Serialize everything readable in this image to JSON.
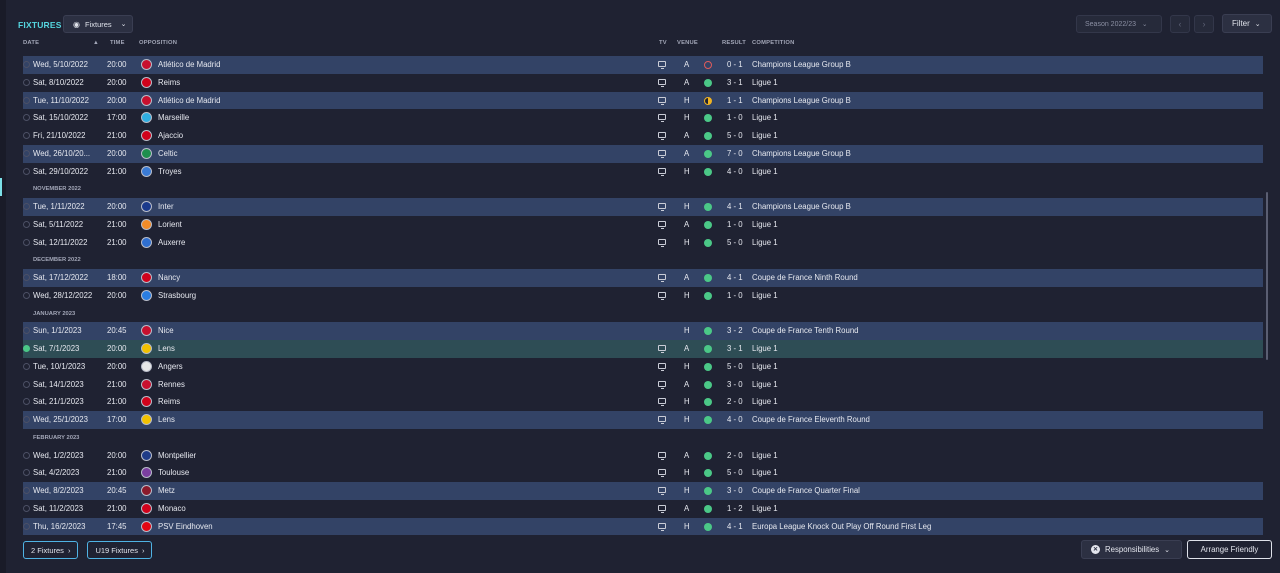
{
  "title": "FIXTURES",
  "view_button": {
    "label": "Fixtures",
    "icon": "eye-icon"
  },
  "season": {
    "label": "Season 2022/23"
  },
  "filter_label": "Filter",
  "columns": {
    "date": "DATE",
    "time": "TIME",
    "opposition": "OPPOSITION",
    "tv": "TV",
    "venue": "VENUE",
    "result": "RESULT",
    "competition": "COMPETITION"
  },
  "rows": [
    {
      "kind": "fixture",
      "style": "alt",
      "date": "Wed, 5/10/2022",
      "time": "20:00",
      "opponent": "Atlético de Madrid",
      "crest": "#c8102e",
      "tv": true,
      "venue": "A",
      "outcome": "loss",
      "score": "0 - 1",
      "competition": "Champions League Group B"
    },
    {
      "kind": "fixture",
      "style": "plain",
      "date": "Sat, 8/10/2022",
      "time": "20:00",
      "opponent": "Reims",
      "crest": "#d0021b",
      "tv": true,
      "venue": "A",
      "outcome": "win",
      "score": "3 - 1",
      "competition": "Ligue 1"
    },
    {
      "kind": "fixture",
      "style": "alt",
      "date": "Tue, 11/10/2022",
      "time": "20:00",
      "opponent": "Atlético de Madrid",
      "crest": "#c8102e",
      "tv": true,
      "venue": "H",
      "outcome": "draw",
      "score": "1 - 1",
      "competition": "Champions League Group B"
    },
    {
      "kind": "fixture",
      "style": "plain",
      "date": "Sat, 15/10/2022",
      "time": "17:00",
      "opponent": "Marseille",
      "crest": "#2faee0",
      "tv": true,
      "venue": "H",
      "outcome": "win",
      "score": "1 - 0",
      "competition": "Ligue 1"
    },
    {
      "kind": "fixture",
      "style": "plain",
      "date": "Fri, 21/10/2022",
      "time": "21:00",
      "opponent": "Ajaccio",
      "crest": "#d0021b",
      "tv": true,
      "venue": "A",
      "outcome": "win",
      "score": "5 - 0",
      "competition": "Ligue 1"
    },
    {
      "kind": "fixture",
      "style": "alt",
      "date": "Wed, 26/10/20...",
      "time": "20:00",
      "opponent": "Celtic",
      "crest": "#1e8f4e",
      "tv": true,
      "venue": "A",
      "outcome": "win",
      "score": "7 - 0",
      "competition": "Champions League Group B"
    },
    {
      "kind": "fixture",
      "style": "plain",
      "date": "Sat, 29/10/2022",
      "time": "21:00",
      "opponent": "Troyes",
      "crest": "#3a7bd5",
      "tv": true,
      "venue": "H",
      "outcome": "win",
      "score": "4 - 0",
      "competition": "Ligue 1"
    },
    {
      "kind": "month",
      "label": "NOVEMBER 2022"
    },
    {
      "kind": "fixture",
      "style": "alt",
      "date": "Tue, 1/11/2022",
      "time": "20:00",
      "opponent": "Inter",
      "crest": "#1b3a8c",
      "tv": true,
      "venue": "H",
      "outcome": "win",
      "score": "4 - 1",
      "competition": "Champions League Group B"
    },
    {
      "kind": "fixture",
      "style": "plain",
      "date": "Sat, 5/11/2022",
      "time": "21:00",
      "opponent": "Lorient",
      "crest": "#f28c28",
      "tv": true,
      "venue": "A",
      "outcome": "win",
      "score": "1 - 0",
      "competition": "Ligue 1"
    },
    {
      "kind": "fixture",
      "style": "plain",
      "date": "Sat, 12/11/2022",
      "time": "21:00",
      "opponent": "Auxerre",
      "crest": "#2f6fd0",
      "tv": true,
      "venue": "H",
      "outcome": "win",
      "score": "5 - 0",
      "competition": "Ligue 1"
    },
    {
      "kind": "month",
      "label": "DECEMBER 2022"
    },
    {
      "kind": "fixture",
      "style": "alt",
      "date": "Sat, 17/12/2022",
      "time": "18:00",
      "opponent": "Nancy",
      "crest": "#d0021b",
      "tv": true,
      "venue": "A",
      "outcome": "win",
      "score": "4 - 1",
      "competition": "Coupe de France Ninth Round"
    },
    {
      "kind": "fixture",
      "style": "plain",
      "date": "Wed, 28/12/2022",
      "time": "20:00",
      "opponent": "Strasbourg",
      "crest": "#2a7de1",
      "tv": true,
      "venue": "H",
      "outcome": "win",
      "score": "1 - 0",
      "competition": "Ligue 1"
    },
    {
      "kind": "month",
      "label": "JANUARY 2023"
    },
    {
      "kind": "fixture",
      "style": "alt",
      "date": "Sun, 1/1/2023",
      "time": "20:45",
      "opponent": "Nice",
      "crest": "#c8102e",
      "tv": false,
      "venue": "H",
      "outcome": "win",
      "score": "3 - 2",
      "competition": "Coupe de France Tenth Round"
    },
    {
      "kind": "fixture",
      "style": "current",
      "date": "Sat, 7/1/2023",
      "time": "20:00",
      "opponent": "Lens",
      "crest": "#f2c100",
      "tv": true,
      "venue": "A",
      "outcome": "win",
      "score": "3 - 1",
      "competition": "Ligue 1"
    },
    {
      "kind": "fixture",
      "style": "plain",
      "date": "Tue, 10/1/2023",
      "time": "20:00",
      "opponent": "Angers",
      "crest": "#e8e8e8",
      "tv": true,
      "venue": "H",
      "outcome": "win",
      "score": "5 - 0",
      "competition": "Ligue 1"
    },
    {
      "kind": "fixture",
      "style": "plain",
      "date": "Sat, 14/1/2023",
      "time": "21:00",
      "opponent": "Rennes",
      "crest": "#c8102e",
      "tv": true,
      "venue": "A",
      "outcome": "win",
      "score": "3 - 0",
      "competition": "Ligue 1"
    },
    {
      "kind": "fixture",
      "style": "plain",
      "date": "Sat, 21/1/2023",
      "time": "21:00",
      "opponent": "Reims",
      "crest": "#d0021b",
      "tv": true,
      "venue": "H",
      "outcome": "win",
      "score": "2 - 0",
      "competition": "Ligue 1"
    },
    {
      "kind": "fixture",
      "style": "alt",
      "date": "Wed, 25/1/2023",
      "time": "17:00",
      "opponent": "Lens",
      "crest": "#f2c100",
      "tv": true,
      "venue": "H",
      "outcome": "win",
      "score": "4 - 0",
      "competition": "Coupe de France Eleventh Round"
    },
    {
      "kind": "month",
      "label": "FEBRUARY 2023"
    },
    {
      "kind": "fixture",
      "style": "plain",
      "date": "Wed, 1/2/2023",
      "time": "20:00",
      "opponent": "Montpellier",
      "crest": "#1f3c88",
      "tv": true,
      "venue": "A",
      "outcome": "win",
      "score": "2 - 0",
      "competition": "Ligue 1"
    },
    {
      "kind": "fixture",
      "style": "plain",
      "date": "Sat, 4/2/2023",
      "time": "21:00",
      "opponent": "Toulouse",
      "crest": "#7b3fa0",
      "tv": true,
      "venue": "H",
      "outcome": "win",
      "score": "5 - 0",
      "competition": "Ligue 1"
    },
    {
      "kind": "fixture",
      "style": "alt",
      "date": "Wed, 8/2/2023",
      "time": "20:45",
      "opponent": "Metz",
      "crest": "#8b1a2b",
      "tv": true,
      "venue": "H",
      "outcome": "win",
      "score": "3 - 0",
      "competition": "Coupe de France Quarter Final"
    },
    {
      "kind": "fixture",
      "style": "plain",
      "date": "Sat, 11/2/2023",
      "time": "21:00",
      "opponent": "Monaco",
      "crest": "#d0021b",
      "tv": true,
      "venue": "A",
      "outcome": "win",
      "score": "1 - 2",
      "competition": "Ligue 1"
    },
    {
      "kind": "fixture",
      "style": "alt",
      "date": "Thu, 16/2/2023",
      "time": "17:45",
      "opponent": "PSV Eindhoven",
      "crest": "#e30613",
      "tv": true,
      "venue": "H",
      "outcome": "win",
      "score": "4 - 1",
      "competition": "Europa League Knock Out Play Off Round First Leg"
    }
  ],
  "bottom": {
    "fixtures_2": "2 Fixtures",
    "fixtures_u19": "U19 Fixtures",
    "responsibilities": "Responsibilities",
    "arrange_friendly": "Arrange Friendly"
  },
  "colors": {
    "accent": "#55d6e0",
    "win": "#4bc887",
    "loss": "#e05b5b",
    "draw": "#f0b323",
    "alt_row": "#334366"
  }
}
